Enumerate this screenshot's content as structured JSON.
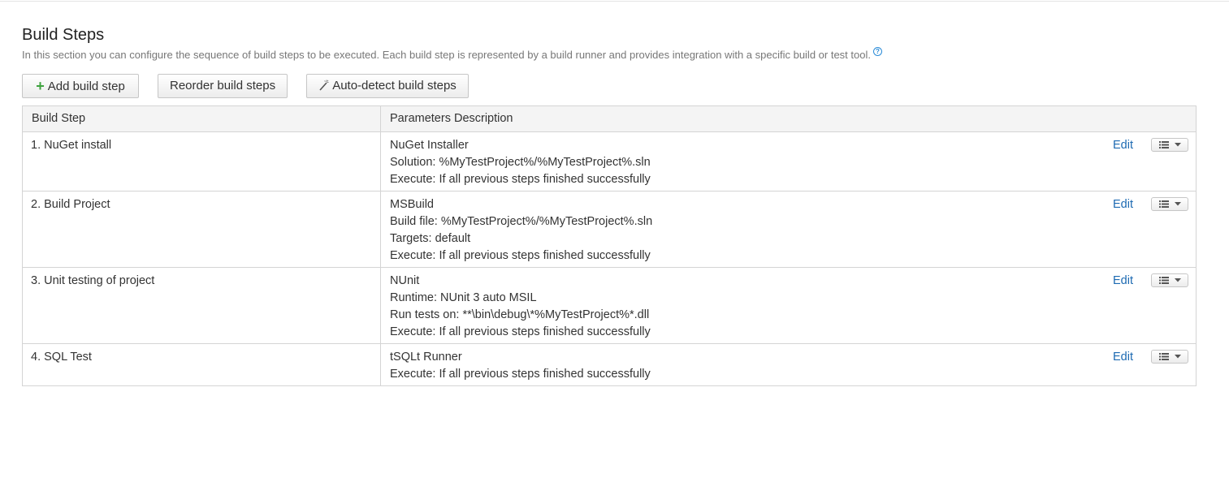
{
  "section": {
    "title": "Build Steps",
    "description": "In this section you can configure the sequence of build steps to be executed. Each build step is represented by a build runner and provides integration with a specific build or test tool.",
    "help_icon": "?"
  },
  "toolbar": {
    "add_icon": "+",
    "add_label": "Add build step",
    "reorder_label": "Reorder build steps",
    "autodetect_label": "Auto-detect build steps"
  },
  "table": {
    "headers": [
      "Build Step",
      "Parameters Description"
    ],
    "edit_label": "Edit",
    "rows": [
      {
        "name": "1. NuGet install",
        "params": [
          "NuGet Installer",
          "Solution: %MyTestProject%/%MyTestProject%.sln",
          "Execute: If all previous steps finished successfully"
        ]
      },
      {
        "name": "2. Build Project",
        "params": [
          "MSBuild",
          "Build file: %MyTestProject%/%MyTestProject%.sln",
          "Targets: default",
          "Execute: If all previous steps finished successfully"
        ]
      },
      {
        "name": "3. Unit testing of project",
        "params": [
          "NUnit",
          "Runtime: NUnit 3 auto MSIL",
          "Run tests on: **\\bin\\debug\\*%MyTestProject%*.dll",
          "Execute: If all previous steps finished successfully"
        ]
      },
      {
        "name": "4. SQL Test",
        "params": [
          "tSQLt Runner",
          "Execute: If all previous steps finished successfully"
        ]
      }
    ]
  },
  "colors": {
    "link": "#1d6ab2",
    "add_icon": "#3fa33f",
    "help_icon": "#2a8bd7"
  },
  "icons": {
    "add": "plus-icon",
    "autodetect": "magic-wand-icon",
    "help": "help-icon",
    "row_menu": "list-menu-icon"
  }
}
